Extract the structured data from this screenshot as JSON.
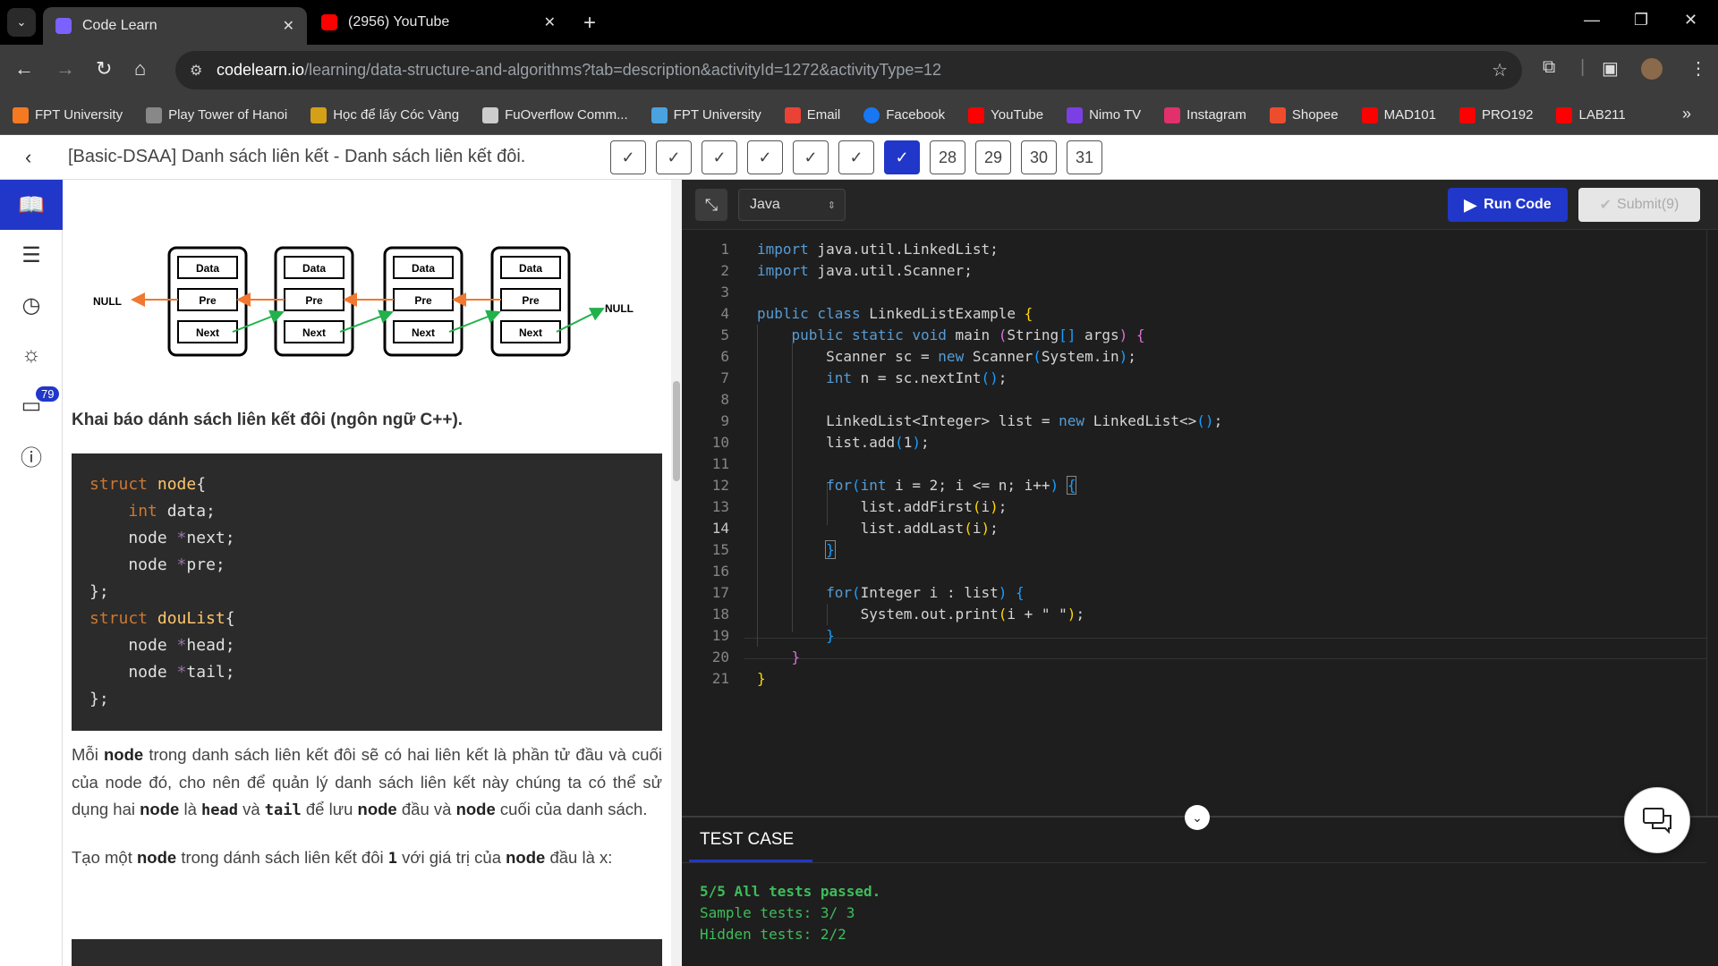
{
  "browser": {
    "tabs": [
      {
        "title": "Code Learn",
        "favicon_color": "#7b61ff"
      },
      {
        "title": "(2956) YouTube",
        "favicon_color": "#ff0000"
      }
    ],
    "url_host": "codelearn.io",
    "url_path": "/learning/data-structure-and-algorithms?tab=description&activityId=1272&activityType=12",
    "bookmarks": [
      {
        "label": "FPT University",
        "color": "#f47920"
      },
      {
        "label": "Play Tower of Hanoi",
        "color": "#888888"
      },
      {
        "label": "Học để lấy Cóc Vàng",
        "color": "#d4a017"
      },
      {
        "label": "FuOverflow Comm...",
        "color": "#cccccc"
      },
      {
        "label": "FPT University",
        "color": "#4aa3df"
      },
      {
        "label": "Email",
        "color": "#ea4335"
      },
      {
        "label": "Facebook",
        "color": "#1877f2"
      },
      {
        "label": "YouTube",
        "color": "#ff0000"
      },
      {
        "label": "Nimo TV",
        "color": "#7b3fe4"
      },
      {
        "label": "Instagram",
        "color": "#e1306c"
      },
      {
        "label": "Shopee",
        "color": "#ee4d2d"
      },
      {
        "label": "MAD101",
        "color": "#ff0000"
      },
      {
        "label": "PRO192",
        "color": "#ff0000"
      },
      {
        "label": "LAB211",
        "color": "#ff0000"
      }
    ]
  },
  "header": {
    "title": "[Basic-DSAA] Danh sách liên kết - Danh sách liên kết đôi.",
    "progress": [
      "✓",
      "✓",
      "✓",
      "✓",
      "✓",
      "✓",
      "✓",
      "28",
      "29",
      "30",
      "31"
    ],
    "current_index": 6
  },
  "rail": {
    "badge": "79"
  },
  "lesson": {
    "diagram": {
      "node_fields": [
        "Data",
        "Pre",
        "Next"
      ],
      "null_left": "NULL",
      "null_right": "NULL"
    },
    "heading": "Khai báo dánh sách liên kết đôi (ngôn ngữ C++).",
    "para1": {
      "t1": "Mỗi ",
      "b1": "node",
      "t2": " trong danh sách liên kết đôi sẽ có hai liên kết là phần tử đầu và cuối của node đó, cho nên để quản lý danh sách liên kết này chúng ta có thể sử dụng hai ",
      "b2": "node",
      "t3": " là ",
      "c1": "head",
      "t4": " và ",
      "c2": "tail",
      "t5": " để lưu ",
      "b3": "node",
      "t6": " đầu và ",
      "b4": "node",
      "t7": " cuối của danh sách."
    },
    "para2": {
      "t1": "Tạo một ",
      "b1": "node",
      "t2": " trong dánh sách liên kết đôi ",
      "c1": "1",
      "t3": " với giá trị của ",
      "b2": "node",
      "t4": " đầu là x:"
    }
  },
  "editor": {
    "language": "Java",
    "run_label": "Run Code",
    "submit_label": "Submit(9)",
    "current_line": 14
  },
  "testcase": {
    "tab_label": "TEST CASE",
    "summary": "5/5 All tests passed.",
    "sample": "Sample tests: 3/ 3",
    "hidden": "Hidden tests: 2/2"
  }
}
